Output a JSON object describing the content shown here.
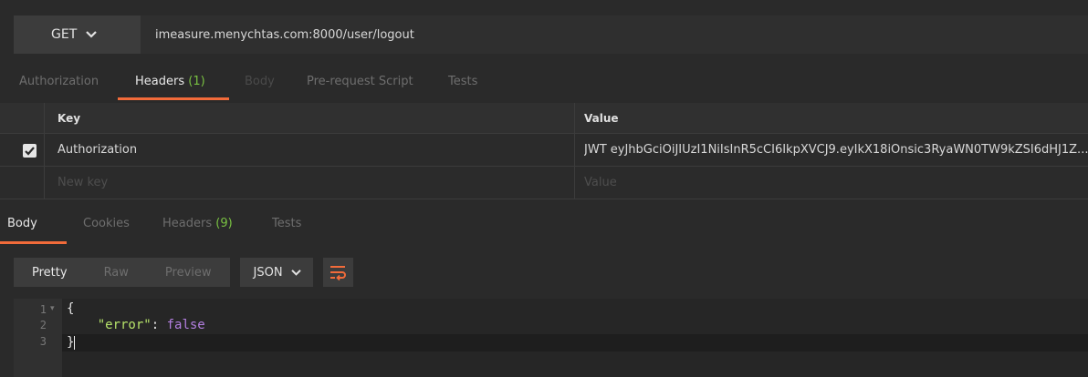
{
  "request": {
    "method": "GET",
    "url": "imeasure.menychtas.com:8000/user/logout"
  },
  "request_tabs": [
    {
      "label": "Authorization"
    },
    {
      "label": "Headers",
      "count": "(1)"
    },
    {
      "label": "Body"
    },
    {
      "label": "Pre-request Script"
    },
    {
      "label": "Tests"
    }
  ],
  "headers_table": {
    "key_header": "Key",
    "value_header": "Value",
    "rows": [
      {
        "checked": true,
        "key": "Authorization",
        "value": "JWT eyJhbGciOiJIUzI1NiIsInR5cCI6IkpXVCJ9.eyIkX18iOnsic3RyaWN0TW9kZSI6dHJ1Z..."
      }
    ],
    "new_key_placeholder": "New key",
    "new_value_placeholder": "Value"
  },
  "response_tabs": [
    {
      "label": "Body"
    },
    {
      "label": "Cookies"
    },
    {
      "label": "Headers",
      "count": "(9)"
    },
    {
      "label": "Tests"
    }
  ],
  "view_modes": [
    "Pretty",
    "Raw",
    "Preview"
  ],
  "format": "JSON",
  "code": {
    "line_numbers": [
      "1",
      "2",
      "3"
    ],
    "open_brace": "{",
    "key": "\"error\"",
    "colon": ": ",
    "value": "false",
    "close_brace": "}"
  },
  "colors": {
    "accent": "#f26b3a",
    "count_green": "#79c142",
    "json_key": "#b6e36a",
    "json_bool": "#b37fe0"
  },
  "icons": [
    "chevron-down-icon",
    "checkbox-checked-icon",
    "wrap-lines-icon",
    "fold-arrow-icon"
  ]
}
